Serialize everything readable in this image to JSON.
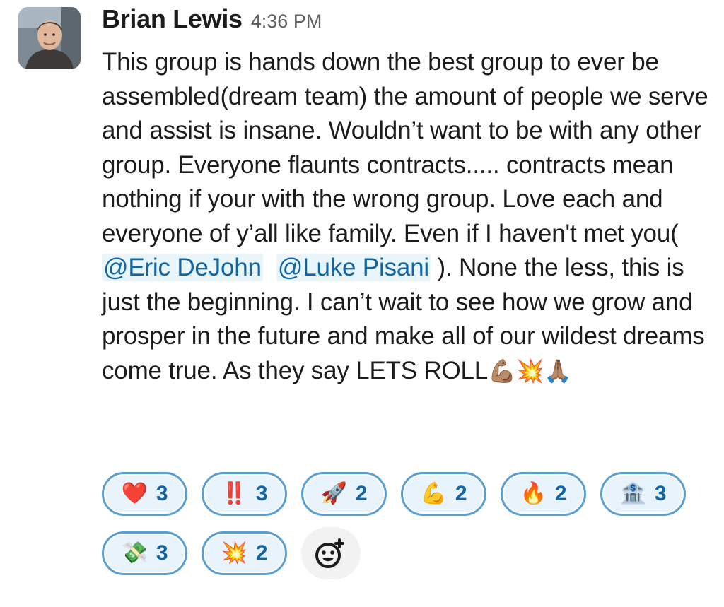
{
  "message": {
    "sender": "Brian Lewis",
    "timestamp": "4:36 PM",
    "text_before_mentions": "This group is hands down the best group to ever be assembled(dream team) the amount of people we serve and assist is insane. Wouldn’t want to be with any other group. Everyone flaunts contracts..... contracts mean nothing if your with the wrong group. Love each and everyone of y’all like family. Even if I haven't met you( ",
    "mention_1": "@Eric DeJohn",
    "mention_2": "@Luke Pisani",
    "text_after_mentions": " ). None the less, this is just the beginning. I can’t wait to see how we grow and prosper in the future and make all of our wildest dreams come true. As they say LETS ROLL",
    "trailing_emojis": "💪🏽💥🙏🏽"
  },
  "reactions": [
    {
      "emoji": "❤️",
      "icon": "red-heart-icon",
      "count": "3"
    },
    {
      "emoji": "‼️",
      "icon": "double-exclamation-icon",
      "count": "3"
    },
    {
      "emoji": "🚀",
      "icon": "rocket-icon",
      "count": "2"
    },
    {
      "emoji": "💪",
      "icon": "flexed-biceps-icon",
      "count": "2"
    },
    {
      "emoji": "🔥",
      "icon": "fire-icon",
      "count": "2"
    },
    {
      "emoji": "🏦",
      "icon": "bank-icon",
      "count": "3"
    },
    {
      "emoji": "💸",
      "icon": "money-with-wings-icon",
      "count": "3"
    },
    {
      "emoji": "💥",
      "icon": "collision-icon",
      "count": "2"
    }
  ],
  "add_reaction": {
    "icon": "add-reaction-smiley-icon"
  },
  "colors": {
    "mention_text": "#1264a3",
    "mention_bg": "#e8f5fa",
    "reaction_border": "#5a9fd4",
    "reaction_bg": "#e8f3fb",
    "count_text": "#1264a3",
    "add_reaction_bg": "#f2f2f2"
  }
}
